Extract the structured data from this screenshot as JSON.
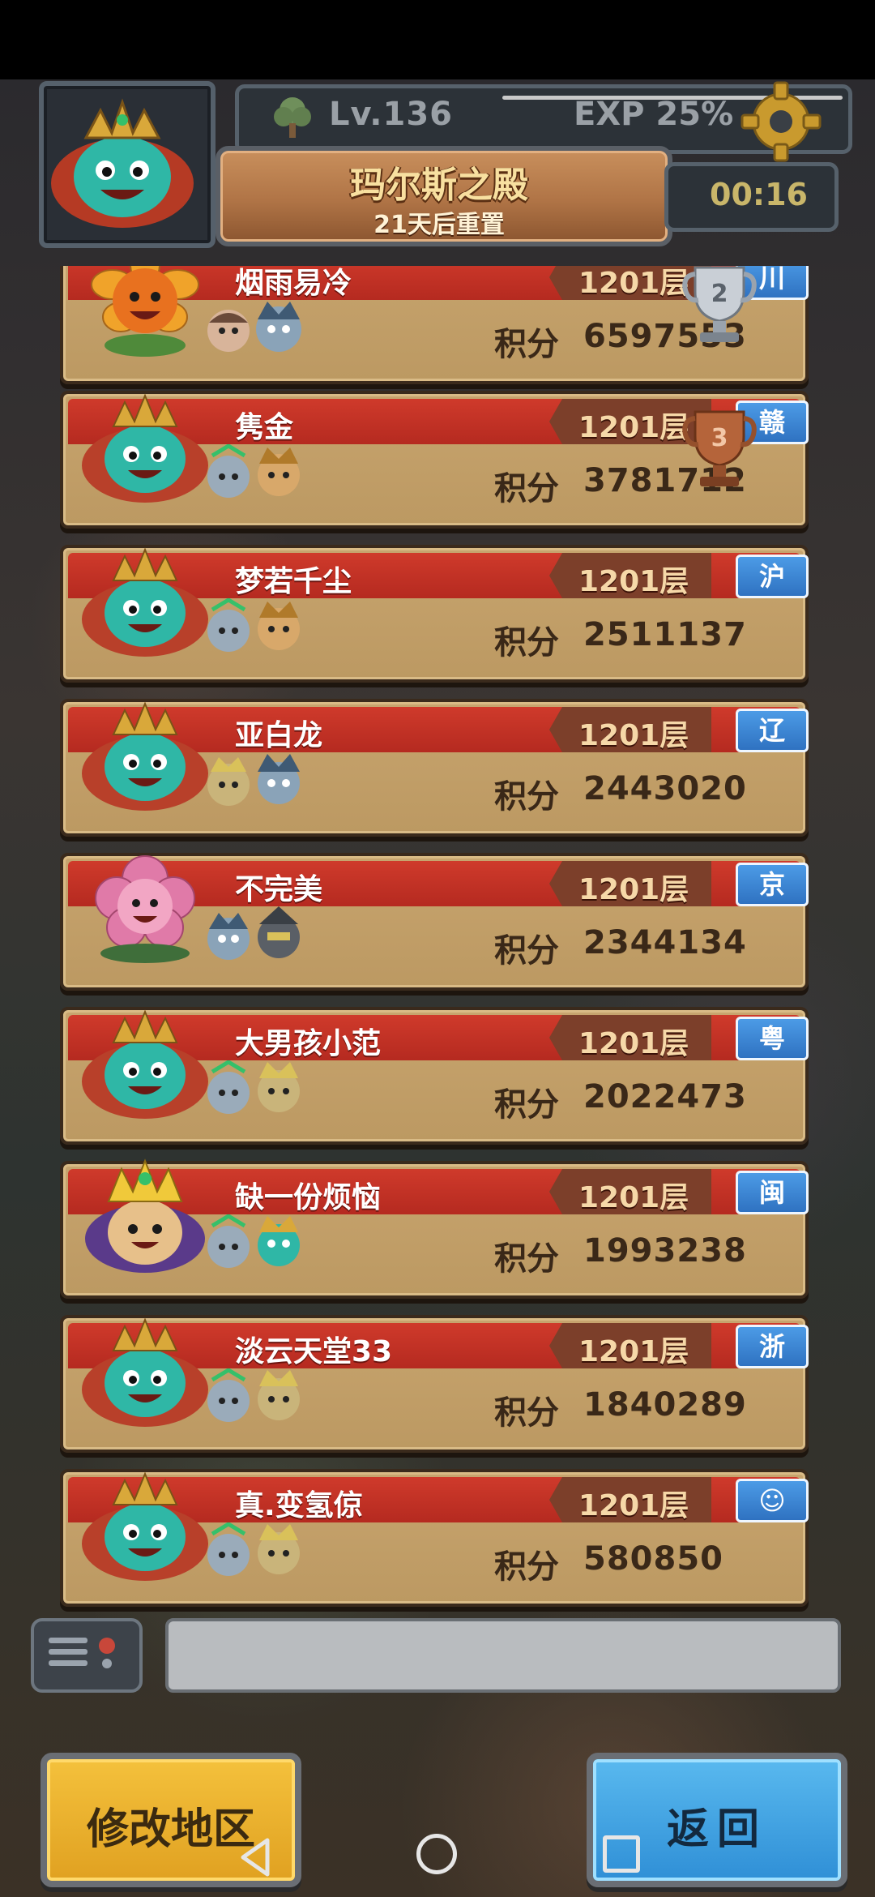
{
  "header": {
    "level": "Lv.136",
    "exp": "EXP 25%",
    "title": "玛尔斯之殿",
    "reset_note": "21天后重置",
    "timer": "00:16"
  },
  "list": {
    "score_label": "积分",
    "entries": [
      {
        "name": "烟雨易冷",
        "floor": "1201层",
        "region": "川",
        "score": "6597553",
        "trophy": "silver",
        "main_hero": "sunflower"
      },
      {
        "name": "隽金",
        "floor": "1201层",
        "region": "赣",
        "score": "3781712",
        "trophy": "bronze",
        "main_hero": "frog-king"
      },
      {
        "name": "梦若千尘",
        "floor": "1201层",
        "region": "沪",
        "score": "2511137",
        "main_hero": "frog-king"
      },
      {
        "name": "亚白龙",
        "floor": "1201层",
        "region": "辽",
        "score": "2443020",
        "main_hero": "frog-king"
      },
      {
        "name": "不完美",
        "floor": "1201层",
        "region": "京",
        "score": "2344134",
        "main_hero": "pink-flower"
      },
      {
        "name": "大男孩小范",
        "floor": "1201层",
        "region": "粤",
        "score": "2022473",
        "main_hero": "frog-king"
      },
      {
        "name": "缺一份烦恼",
        "floor": "1201层",
        "region": "闽",
        "score": "1993238",
        "main_hero": "purple-king"
      },
      {
        "name": "淡云天堂33",
        "floor": "1201层",
        "region": "浙",
        "score": "1840289",
        "main_hero": "frog-king"
      },
      {
        "name": "真.变氢倞",
        "floor": "1201层",
        "region": "☺",
        "score": "580850",
        "main_hero": "frog-king"
      }
    ]
  },
  "buttons": {
    "change_region": "修改地区",
    "back": "返回"
  },
  "colors": {
    "card_band": "#c53327",
    "card_body": "#c4a06a",
    "region_badge": "#3c86d5",
    "btn_yellow": "#ecb12f",
    "btn_blue": "#4aa8e6"
  }
}
